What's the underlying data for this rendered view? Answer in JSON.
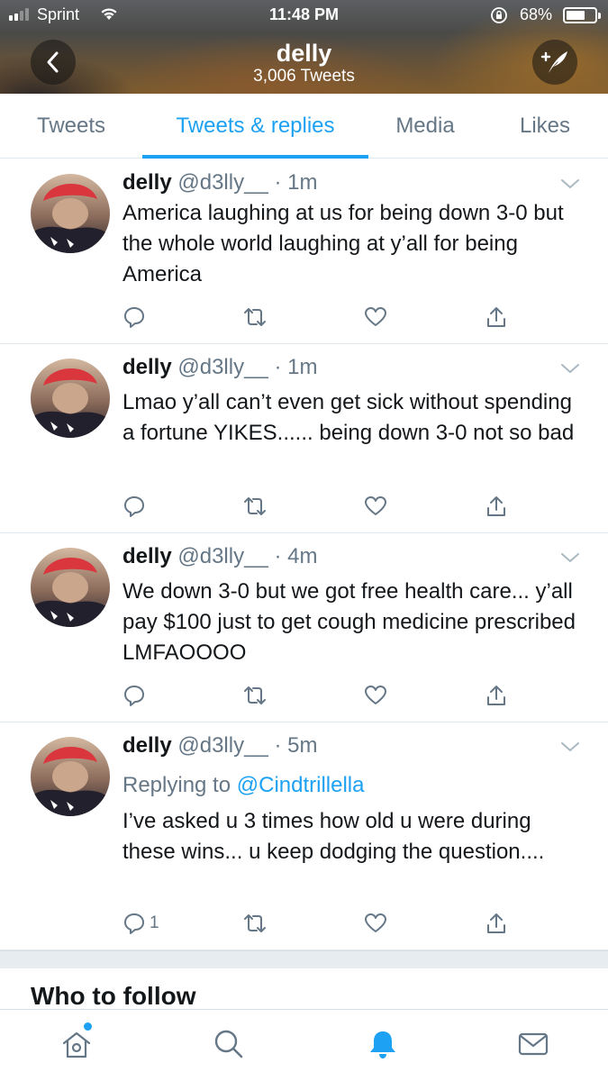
{
  "status_bar": {
    "carrier": "Sprint",
    "time": "11:48 PM",
    "battery": "68%",
    "battery_level": 0.68,
    "signal_bars": 2
  },
  "header": {
    "name": "delly",
    "tweet_count": "3,006 Tweets",
    "back_icon": "chevron-left-icon",
    "compose_icon": "compose-tweet-icon"
  },
  "tabs": [
    "Tweets",
    "Tweets & replies",
    "Media",
    "Likes"
  ],
  "active_tab": "Tweets & replies",
  "colors": {
    "accent": "#1da1f2",
    "muted": "#657786",
    "text": "#14171a"
  },
  "tweets": [
    {
      "name": "delly",
      "meta": "@d3lly__ · 1m",
      "text": "America laughing at us for being down 3-0 but the whole world laughing at y’all for being America",
      "reply_count": ""
    },
    {
      "name": "delly",
      "meta": "@d3lly__ · 1m",
      "text": "Lmao y’all can’t even get sick without spending a fortune YIKES...... being down 3-0 not so bad",
      "reply_count": ""
    },
    {
      "name": "delly",
      "meta": "@d3lly__ · 4m",
      "text": "We down 3-0 but we got free health care... y’all pay $100 just to get cough medicine prescribed LMFAOOOO",
      "reply_count": ""
    },
    {
      "name": "delly",
      "meta": "@d3lly__ · 5m",
      "replying_prefix": "Replying to",
      "replying_mention": "@Cindtrillella",
      "text": "I’ve asked u 3 times how old u were during these wins... u keep dodging the question....",
      "reply_count": "1"
    }
  ],
  "who_to_follow": "Who to follow",
  "bottom_nav": [
    "home-icon",
    "search-icon",
    "notifications-icon",
    "messages-icon"
  ],
  "active_bottom_nav": "notifications-icon"
}
